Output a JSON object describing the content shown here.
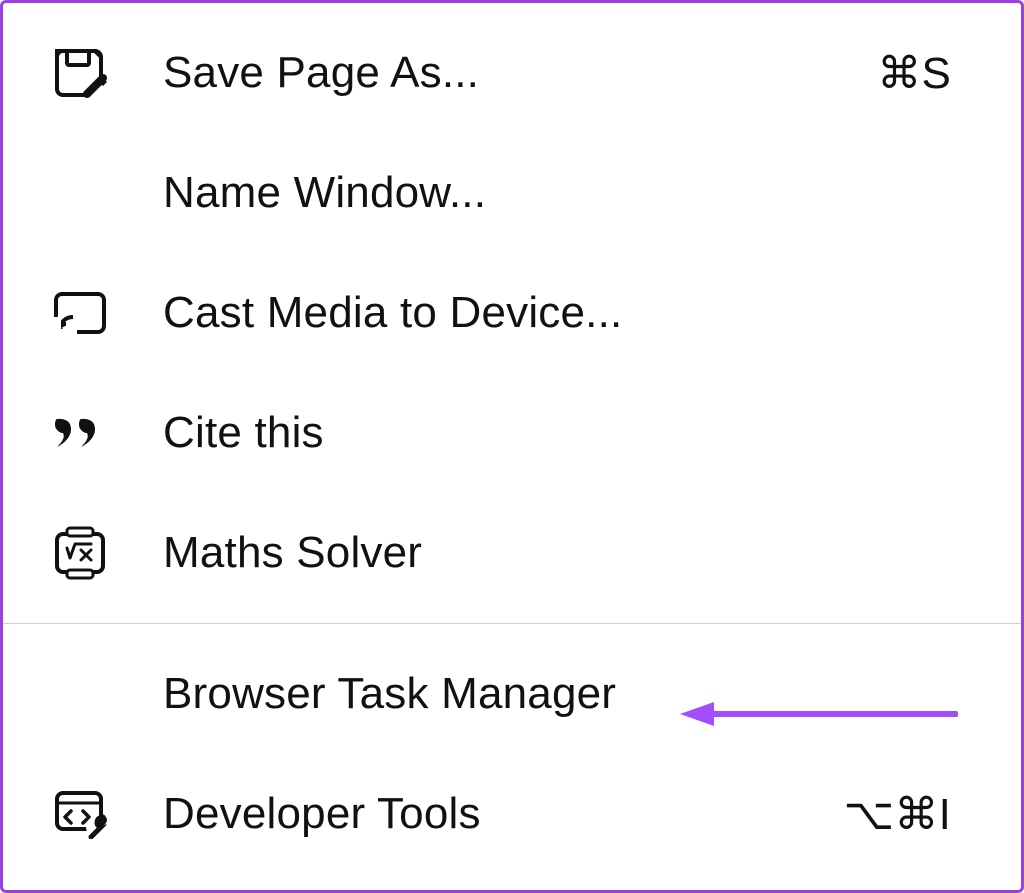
{
  "menu": {
    "items": [
      {
        "label": "Save Page As...",
        "shortcut": "⌘S",
        "icon": "save"
      },
      {
        "label": "Name Window...",
        "shortcut": "",
        "icon": ""
      },
      {
        "label": "Cast Media to Device...",
        "shortcut": "",
        "icon": "cast"
      },
      {
        "label": "Cite this",
        "shortcut": "",
        "icon": "quote"
      },
      {
        "label": "Maths Solver",
        "shortcut": "",
        "icon": "math"
      }
    ],
    "items2": [
      {
        "label": "Browser Task Manager",
        "shortcut": "",
        "icon": ""
      },
      {
        "label": "Developer Tools",
        "shortcut": "⌥⌘I",
        "icon": "dev"
      }
    ]
  },
  "annotation": {
    "arrow_color": "#a24dff"
  }
}
